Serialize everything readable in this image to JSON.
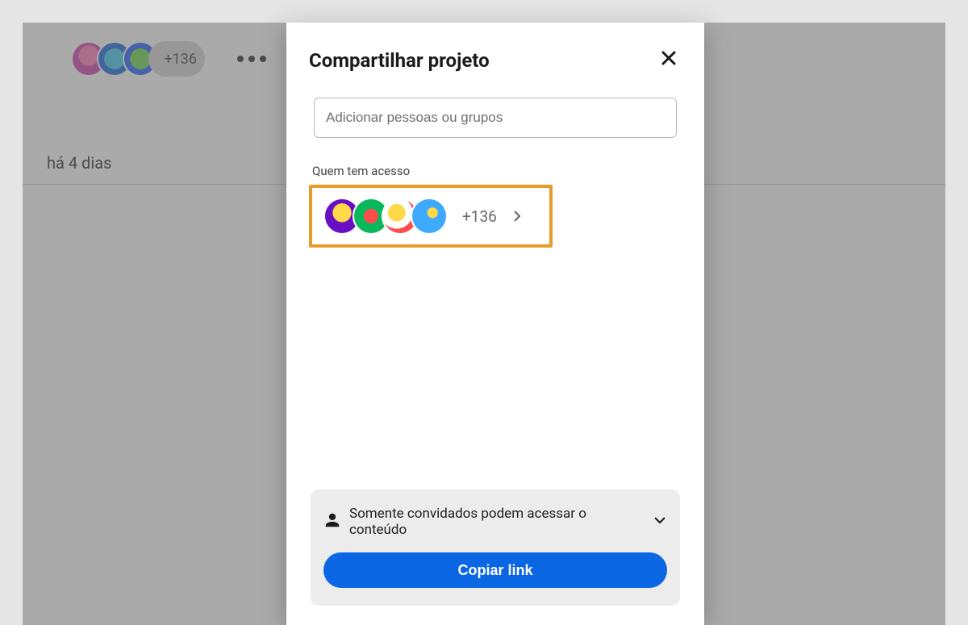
{
  "background": {
    "avatars_count_label": "+136",
    "timestamp": "há 4 dias"
  },
  "dialog": {
    "title": "Compartilhar projeto",
    "people_placeholder": "Adicionar pessoas ou grupos",
    "access_label": "Quem tem acesso",
    "count_label": "+136",
    "permission_text": "Somente convidados podem acessar o conteúdo",
    "copy_button": "Copiar link"
  }
}
